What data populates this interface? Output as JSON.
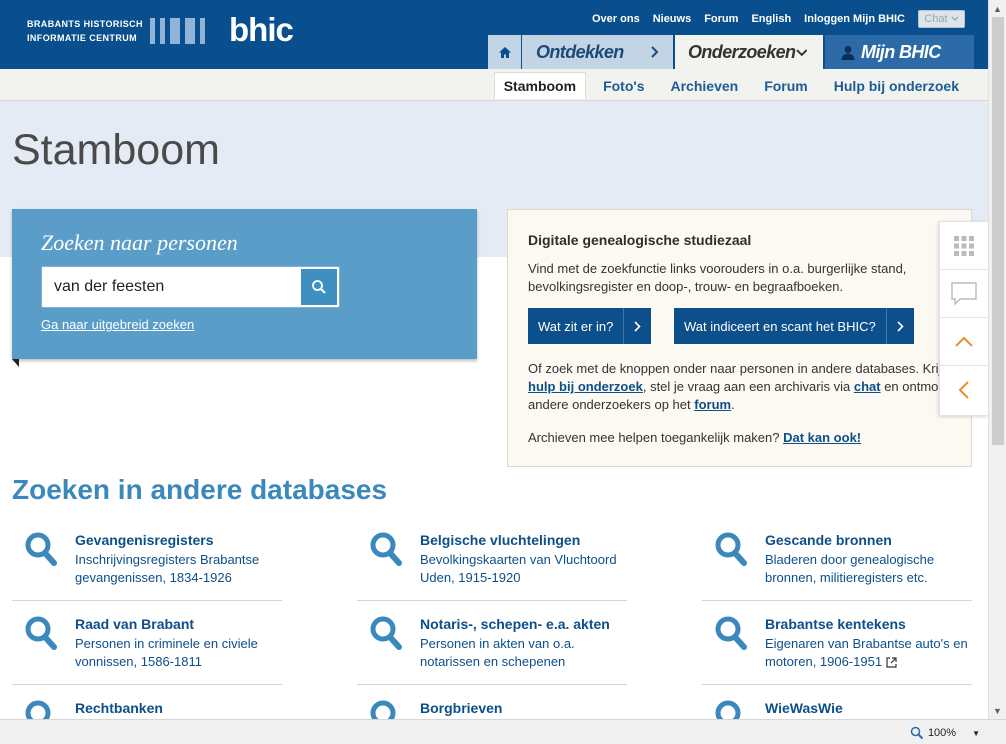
{
  "header": {
    "logo_line1": "BRABANTS HISTORISCH",
    "logo_line2": "INFORMATIE CENTRUM",
    "logo_word": "bhic",
    "utility_links": [
      "Over ons",
      "Nieuws",
      "Forum",
      "English",
      "Inloggen Mijn BHIC"
    ],
    "chat_label": "Chat",
    "tabs": {
      "ontdekken": "Ontdekken",
      "onderzoeken": "Onderzoeken",
      "mijn": "Mijn BHIC"
    },
    "subnav": [
      "Stamboom",
      "Foto's",
      "Archieven",
      "Forum",
      "Hulp bij onderzoek"
    ]
  },
  "page": {
    "title": "Stamboom"
  },
  "search": {
    "title": "Zoeken naar personen",
    "value": "van der feesten",
    "advanced_link": "Ga naar uitgebreid zoeken"
  },
  "info": {
    "title": "Digitale genealogische studiezaal",
    "intro": "Vind met de zoekfunctie links voorouders in o.a. burgerlijke stand, bevolkingsregister en doop-, trouw- en begraafboeken.",
    "btn1": "Wat zit er in?",
    "btn2": "Wat indiceert en scant het BHIC?",
    "p2_a": "Of zoek met de knoppen onder naar personen in andere databases. Krijg ",
    "p2_link1": "hulp bij onderzoek",
    "p2_b": ", stel je vraag aan een archivaris via ",
    "p2_link2": "chat",
    "p2_c": " en ontmoet andere onderzoekers op het ",
    "p2_link3": "forum",
    "p2_d": ".",
    "p3_a": "Archieven mee helpen toegankelijk maken? ",
    "p3_link": "Dat kan ook!"
  },
  "databases": {
    "title": "Zoeken in andere databases",
    "items": [
      {
        "name": "Gevangenisregisters",
        "desc": "Inschrijvingsregisters Brabantse gevangenissen, 1834-1926"
      },
      {
        "name": "Belgische vluchtelingen",
        "desc": "Bevolkingskaarten van Vluchtoord Uden, 1915-1920"
      },
      {
        "name": "Gescande bronnen",
        "desc": "Bladeren door genealogische bronnen, militieregisters etc."
      },
      {
        "name": "Raad van Brabant",
        "desc": "Personen in criminele en civiele vonnissen, 1586-1811"
      },
      {
        "name": "Notaris-, schepen- e.a. akten",
        "desc": "Personen in akten van o.a. notarissen en schepenen"
      },
      {
        "name": "Brabantse kentekens",
        "desc": "Eigenaren van Brabantse auto's en motoren, 1906-1951"
      },
      {
        "name": "Rechtbanken",
        "desc": ""
      },
      {
        "name": "Borgbrieven",
        "desc": ""
      },
      {
        "name": "WieWasWie",
        "desc": ""
      }
    ]
  },
  "status": {
    "zoom": "100%"
  },
  "colors": {
    "brand_blue": "#0a4f8d",
    "link_blue": "#0d4f8a",
    "search_panel": "#5b9dc9",
    "accent_orange": "#e8902c"
  },
  "icons": [
    "home-icon",
    "chevron-right-icon",
    "chevron-down-icon",
    "user-icon",
    "search-icon",
    "grid-icon",
    "chat-bubble-icon",
    "chevron-up-icon",
    "chevron-left-icon",
    "magnifier-icon",
    "external-link-icon",
    "zoom-icon"
  ]
}
